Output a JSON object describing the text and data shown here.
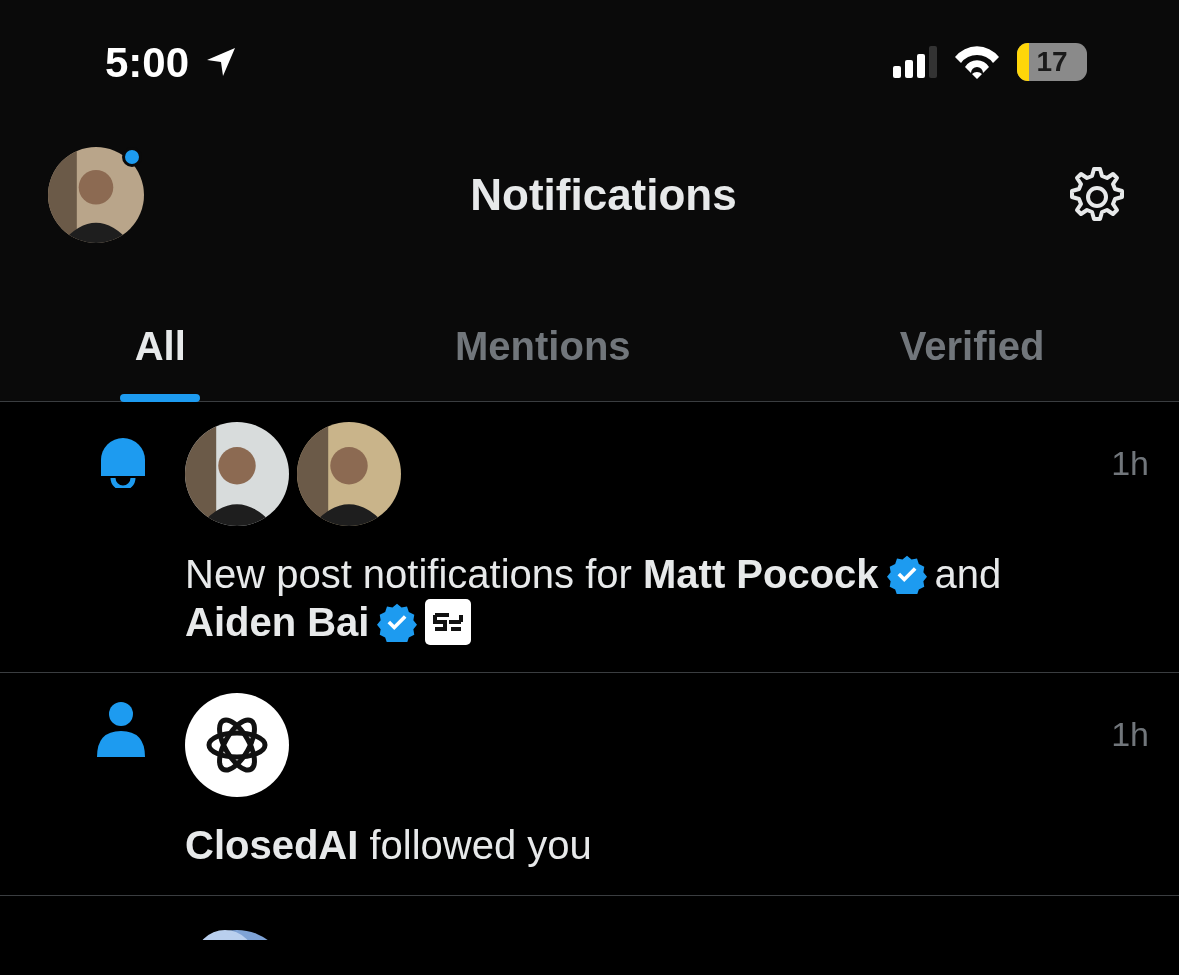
{
  "status_bar": {
    "time": "5:00",
    "battery": "17"
  },
  "header": {
    "title": "Notifications",
    "has_unread_dot": true
  },
  "tabs": [
    {
      "label": "All",
      "selected": true
    },
    {
      "label": "Mentions",
      "selected": false
    },
    {
      "label": "Verified",
      "selected": false
    }
  ],
  "notifications": [
    {
      "kind": "bell",
      "avatars": [
        {
          "kind": "picture"
        },
        {
          "kind": "picture"
        }
      ],
      "time": "1h",
      "lines": [
        [
          {
            "kind": "text",
            "text": "New post notifications for **Matt Pocock**"
          },
          {
            "kind": "verified"
          },
          {
            "kind": "text",
            "text": "and"
          }
        ],
        [
          {
            "kind": "text",
            "text": "**Aiden Bai**"
          },
          {
            "kind": "verified"
          },
          {
            "kind": "affiliate"
          }
        ]
      ]
    },
    {
      "kind": "follow",
      "avatars": [
        {
          "kind": "logo"
        }
      ],
      "time": "1h",
      "lines": [
        [
          {
            "kind": "text",
            "text": "**ClosedAI** followed you"
          }
        ]
      ]
    }
  ]
}
